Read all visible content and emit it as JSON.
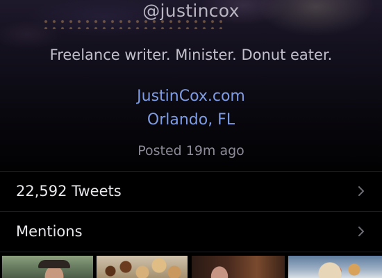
{
  "profile": {
    "handle": "@justincox",
    "bio": "Freelance writer. Minister. Donut eater.",
    "website": "JustinCox.com",
    "location": "Orlando, FL",
    "posted": "Posted 19m ago"
  },
  "rows": {
    "tweets_label": "22,592 Tweets",
    "mentions_label": "Mentions"
  },
  "icons": {
    "row_chevron": "chevron-right-icon"
  },
  "colors": {
    "background": "#000000",
    "link": "#7d9ce5",
    "primary_text": "#e8e8ec",
    "secondary_text": "#8e8b99"
  }
}
